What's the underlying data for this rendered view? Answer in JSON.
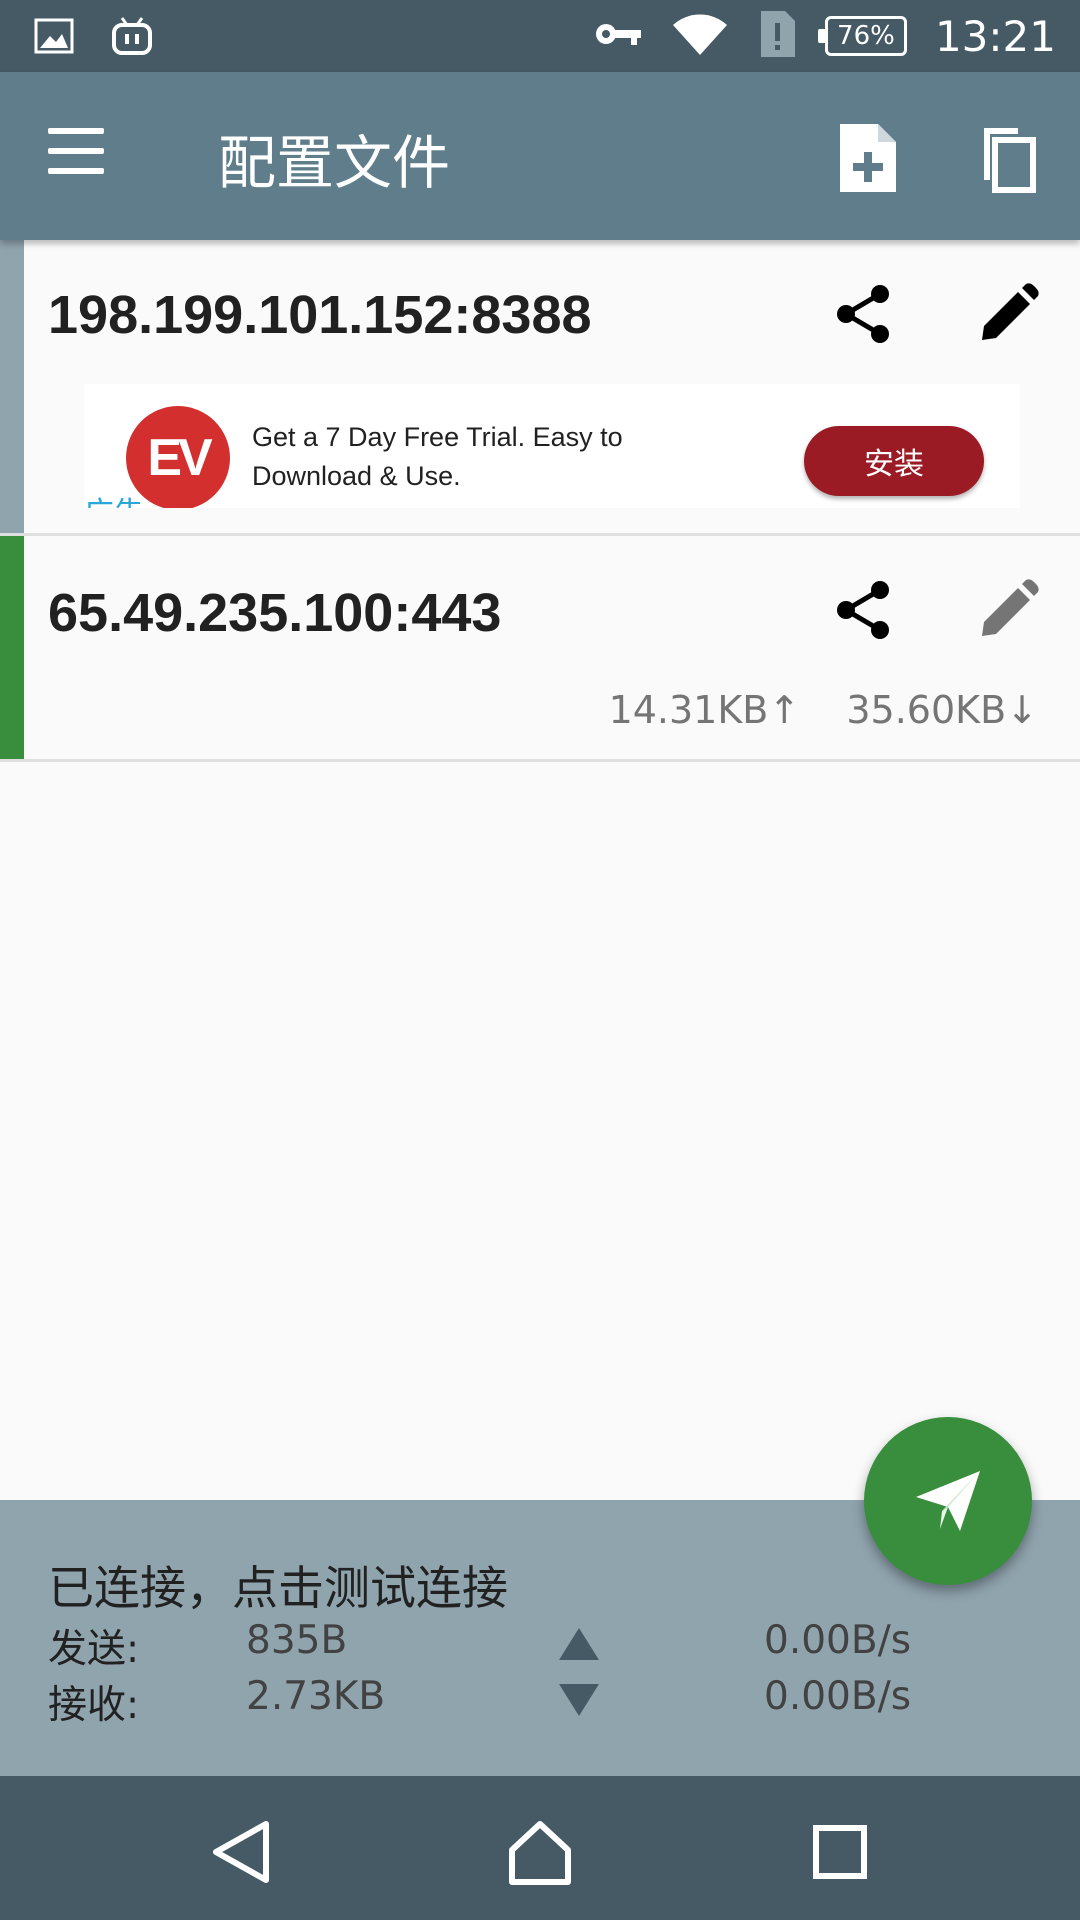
{
  "status_bar": {
    "time": "13:21",
    "battery": "76%",
    "icons": [
      "gallery-icon",
      "bot-icon",
      "vpn-key-icon",
      "wifi-icon",
      "sim-alert-icon",
      "battery-icon"
    ]
  },
  "app_bar": {
    "title": "配置文件",
    "icons": [
      "menu-icon",
      "add-file-icon",
      "copy-icon"
    ]
  },
  "profiles": [
    {
      "name": "198.199.101.152:8388",
      "accent_color": "#90a4ae",
      "active": false
    },
    {
      "name": "65.49.235.100:443",
      "accent_color": "#388e3c",
      "active": true,
      "upload": "14.31KB↑",
      "download": "35.60KB↓"
    }
  ],
  "ad": {
    "logo_text": "EV",
    "text": "Get a 7 Day Free Trial. Easy to Download & Use.",
    "button_label": "安装",
    "label": "广告"
  },
  "stats": {
    "status": "已连接，点击测试连接",
    "send_label": "发送:",
    "send_total": "835B",
    "send_rate": "0.00B/s",
    "recv_label": "接收:",
    "recv_total": "2.73KB",
    "recv_rate": "0.00B/s"
  },
  "colors": {
    "primary": "#607d8b",
    "primary_dark": "#455a64",
    "panel": "#90a4ae",
    "fab": "#388e3c",
    "ad_button": "#9b1b24"
  }
}
